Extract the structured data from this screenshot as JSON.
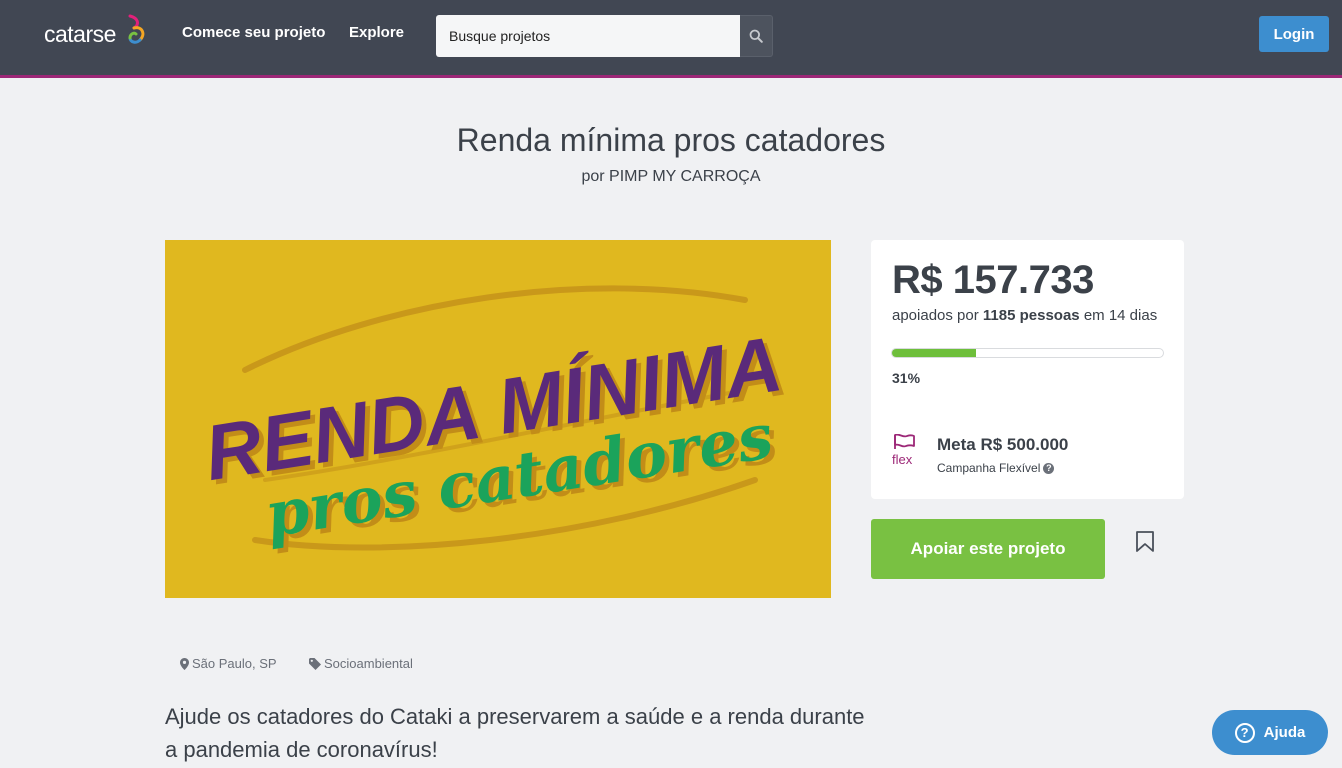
{
  "header": {
    "logo_text": "catarse",
    "nav": {
      "start_project": "Comece seu projeto",
      "explore": "Explore"
    },
    "search": {
      "placeholder": "Busque projetos"
    },
    "login_label": "Login"
  },
  "project": {
    "title": "Renda mínima pros catadores",
    "byline": "por PIMP MY CARROÇA",
    "cover_text": {
      "line1": "RENDA MÍNIMA",
      "line2": "pros catadores"
    },
    "location": "São Paulo, SP",
    "category": "Socioambiental",
    "headline": "Ajude os catadores do Cataki a preservarem a saúde e a renda durante a pandemia de coronavírus!"
  },
  "stats": {
    "amount": "R$ 157.733",
    "backed_prefix": "apoiados por",
    "backers": "1185 pessoas",
    "backed_suffix": "em 14 dias",
    "progress_percent": 31,
    "percent_label": "31%",
    "flex_label": "flex",
    "goal": "Meta R$ 500.000",
    "campaign_type": "Campanha Flexível",
    "help_glyph": "?"
  },
  "actions": {
    "back_label": "Apoiar este projeto"
  },
  "help_widget": {
    "label": "Ajuda",
    "glyph": "?"
  },
  "colors": {
    "header": "#414753",
    "accent": "#9c2777",
    "login": "#3d8ecf",
    "back_button": "#79c142",
    "cover": "#e0b81f",
    "progress": "#6ebf3b"
  },
  "icons": [
    "logo-mark-icon",
    "search-icon",
    "flex-flag-icon",
    "bookmark-icon",
    "map-pin-icon",
    "tag-icon",
    "help-icon"
  ]
}
